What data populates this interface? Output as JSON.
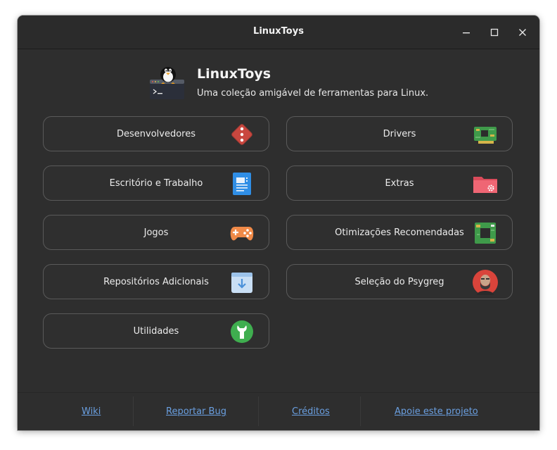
{
  "window": {
    "title": "LinuxToys"
  },
  "header": {
    "app_name": "LinuxToys",
    "description": "Uma coleção amigável de ferramentas para Linux."
  },
  "categories": [
    {
      "label": "Desenvolvedores",
      "icon": "dice-icon"
    },
    {
      "label": "Drivers",
      "icon": "circuit-board-icon"
    },
    {
      "label": "Escritório e Trabalho",
      "icon": "document-icon"
    },
    {
      "label": "Extras",
      "icon": "folder-gear-icon"
    },
    {
      "label": "Jogos",
      "icon": "gamepad-icon"
    },
    {
      "label": "Otimizações Recomendadas",
      "icon": "chip-icon"
    },
    {
      "label": "Repositórios Adicionais",
      "icon": "download-bag-icon"
    },
    {
      "label": "Seleção do Psygreg",
      "icon": "avatar-icon"
    },
    {
      "label": "Utilidades",
      "icon": "wrench-icon"
    }
  ],
  "footer": {
    "links": [
      "Wiki",
      "Reportar Bug",
      "Créditos",
      "Apoie este projeto"
    ]
  },
  "colors": {
    "window_bg": "#2e2e2e",
    "link": "#6a9fe0",
    "button_border": "#5a5a5a"
  }
}
